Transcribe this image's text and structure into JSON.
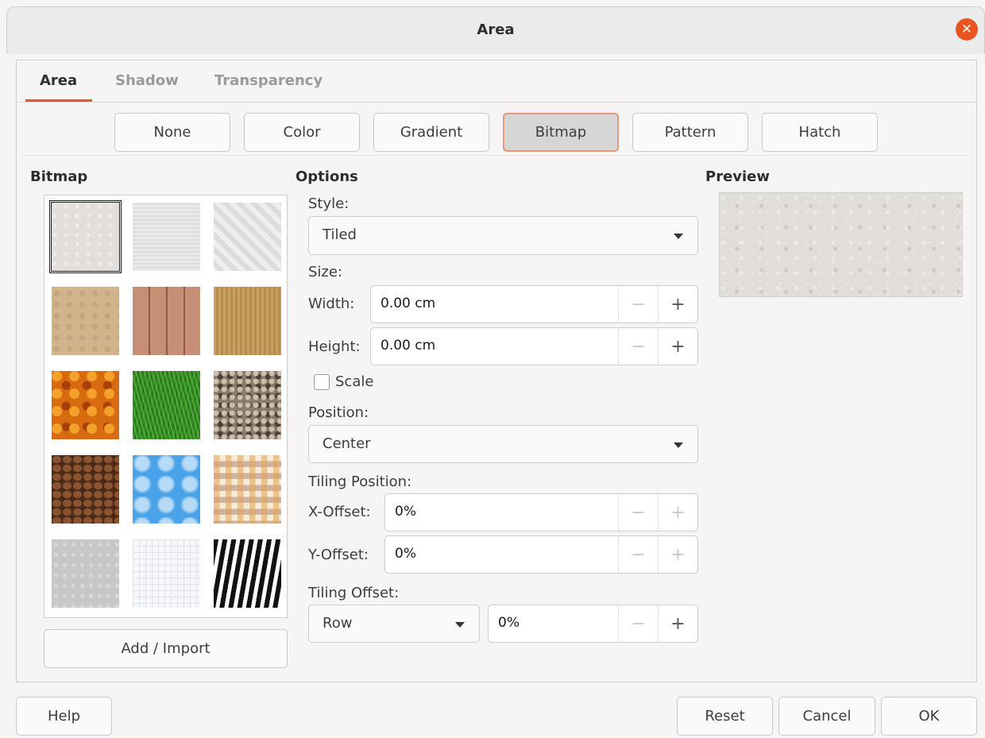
{
  "window": {
    "title": "Area",
    "close_icon": "close-icon"
  },
  "tabs": [
    {
      "label": "Area",
      "active": true
    },
    {
      "label": "Shadow",
      "active": false
    },
    {
      "label": "Transparency",
      "active": false
    }
  ],
  "fill_types": [
    {
      "label": "None",
      "active": false
    },
    {
      "label": "Color",
      "active": false
    },
    {
      "label": "Gradient",
      "active": false
    },
    {
      "label": "Bitmap",
      "active": true
    },
    {
      "label": "Pattern",
      "active": false
    },
    {
      "label": "Hatch",
      "active": false
    }
  ],
  "bitmap": {
    "label": "Bitmap",
    "selected_index": 0,
    "add_import_label": "Add / Import"
  },
  "options": {
    "label": "Options",
    "style_label": "Style:",
    "style_value": "Tiled",
    "size_label": "Size:",
    "width_label": "Width:",
    "width_value": "0.00 cm",
    "height_label": "Height:",
    "height_value": "0.00 cm",
    "scale_label": "Scale",
    "scale_checked": false,
    "position_label": "Position:",
    "position_value": "Center",
    "tiling_position_label": "Tiling Position:",
    "x_offset_label": "X-Offset:",
    "x_offset_value": "0%",
    "y_offset_label": "Y-Offset:",
    "y_offset_value": "0%",
    "tiling_offset_label": "Tiling Offset:",
    "tiling_offset_mode": "Row",
    "tiling_offset_value": "0%",
    "minus_symbol": "−",
    "plus_symbol": "+"
  },
  "preview": {
    "label": "Preview"
  },
  "footer": {
    "help_label": "Help",
    "reset_label": "Reset",
    "cancel_label": "Cancel",
    "ok_label": "OK"
  },
  "colors": {
    "accent": "#e95420",
    "selected_button_border": "#e9967a"
  }
}
